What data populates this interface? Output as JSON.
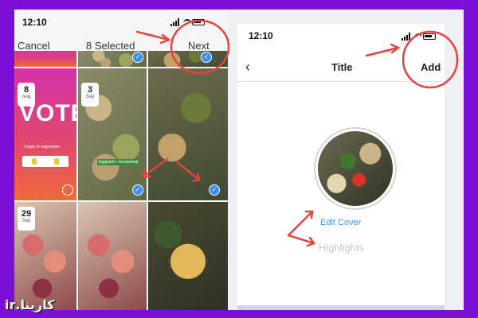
{
  "left_screen": {
    "status_time": "12:10",
    "cancel_label": "Cancel",
    "selected_label": "8 Selected",
    "next_label": "Next",
    "vote_cell": {
      "date_day": "8",
      "date_month": "Aug",
      "title": "VOTE",
      "caption": "Vegan or vegetarian"
    },
    "cells": [
      {
        "date_day": "3",
        "date_month": "Sep",
        "caption": "Eggplant + buckwheat"
      },
      {
        "date_day": "29",
        "date_month": "Sep"
      }
    ]
  },
  "right_screen": {
    "status_time": "12:10",
    "title": "Title",
    "add_label": "Add",
    "edit_cover_label": "Edit Cover",
    "highlights_label": "Highlights"
  },
  "watermark": "کارینا.ir",
  "colors": {
    "background": "#7b0fd6",
    "accent": "#3797f0",
    "annotation": "#e8423c"
  },
  "icons": {
    "back": "chevron-left-icon",
    "check": "checkmark-icon",
    "wifi": "wifi-icon",
    "battery": "battery-icon",
    "signal": "signal-icon"
  }
}
